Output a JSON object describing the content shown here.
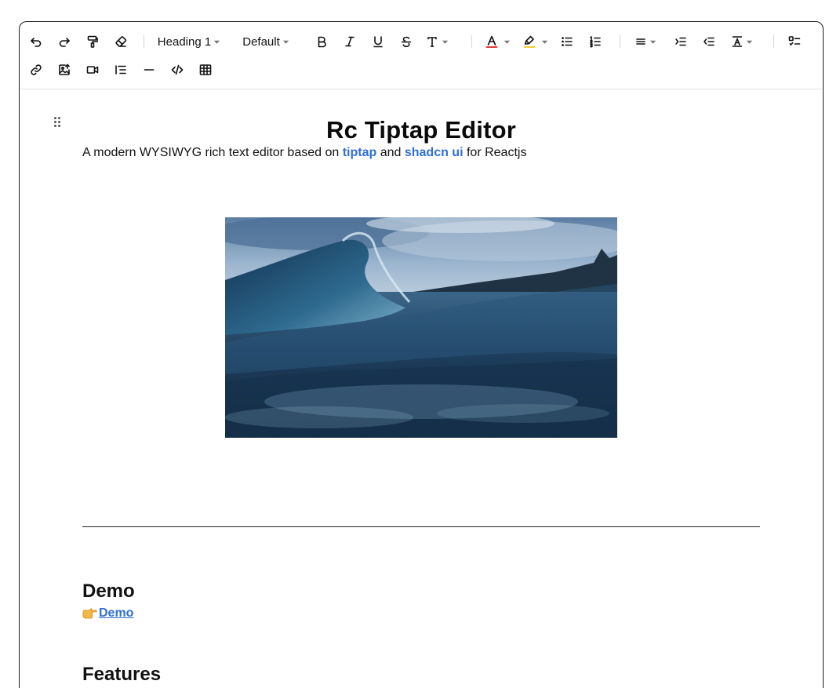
{
  "toolbar": {
    "heading_label": "Heading 1",
    "font_label": "Default",
    "colors": {
      "text_color_underline": "#e11d1d",
      "highlight_underline": "#f5c518"
    },
    "icons": [
      "undo-icon",
      "redo-icon",
      "format-painter-icon",
      "eraser-icon",
      "bold-icon",
      "italic-icon",
      "underline-icon",
      "strikethrough-icon",
      "font-size-icon",
      "text-color-icon",
      "highlight-icon",
      "bullet-list-icon",
      "ordered-list-icon",
      "align-icon",
      "indent-icon",
      "outdent-icon",
      "line-height-icon",
      "task-list-icon",
      "link-icon",
      "image-upload-icon",
      "video-icon",
      "table-of-contents-icon",
      "horizontal-rule-icon",
      "code-icon",
      "table-icon"
    ]
  },
  "document": {
    "title": "Rc Tiptap Editor",
    "lead_prefix": "A modern WYSIWYG rich text editor based on ",
    "lead_link1": "tiptap",
    "lead_middle": " and ",
    "lead_link2": "shadcn ui",
    "lead_suffix": " for Reactjs",
    "demo_heading": "Demo",
    "demo_link": "Demo",
    "features_heading": "Features",
    "link_color": "#2f6fd6"
  }
}
